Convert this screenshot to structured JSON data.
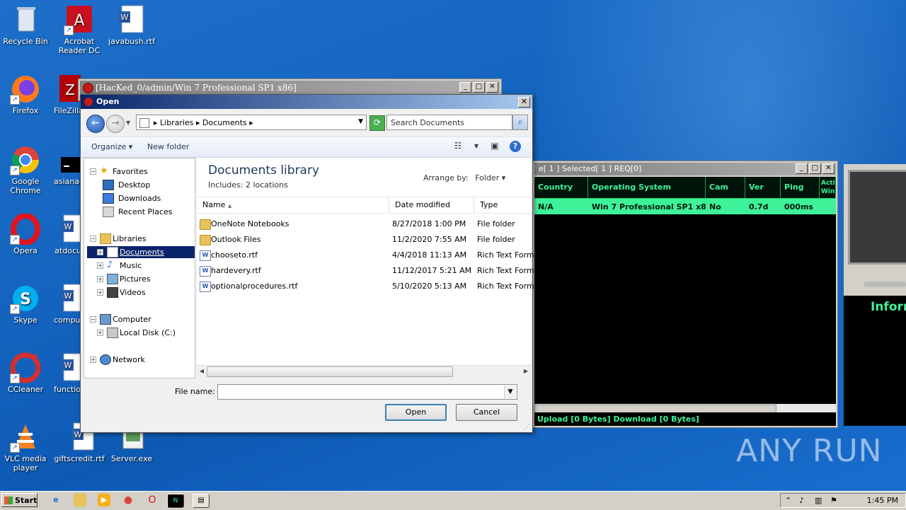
{
  "desktop": {
    "icons": [
      {
        "label": "Recycle Bin",
        "icon": "recycle-bin-icon"
      },
      {
        "label": "Acrobat Reader DC",
        "icon": "acrobat-icon"
      },
      {
        "label": "javabush.rtf",
        "icon": "word-doc-icon"
      },
      {
        "label": "Firefox",
        "icon": "firefox-icon"
      },
      {
        "label": "FileZilla",
        "icon": "filezilla-icon"
      },
      {
        "label": "Google Chrome",
        "icon": "chrome-icon"
      },
      {
        "label": "asianag",
        "icon": "terminal-icon"
      },
      {
        "label": "Opera",
        "icon": "opera-icon"
      },
      {
        "label": "atdocu",
        "icon": "word-doc-icon"
      },
      {
        "label": "Skype",
        "icon": "skype-icon"
      },
      {
        "label": "comput",
        "icon": "word-doc-icon"
      },
      {
        "label": "CCleaner",
        "icon": "ccleaner-icon"
      },
      {
        "label": "function",
        "icon": "word-doc-icon"
      },
      {
        "label": "VLC media player",
        "icon": "vlc-icon"
      },
      {
        "label": "giftscredit.rtf",
        "icon": "word-doc-icon"
      },
      {
        "label": "Server.exe",
        "icon": "exe-icon"
      }
    ],
    "watermark": "ANY RUN"
  },
  "bg_window": {
    "title": "[HacKed_0/admin/Win 7 Professional SP1 x86]"
  },
  "clients_window": {
    "title": "e[ 1 ]   Selected[ 1 ] REQ[0]",
    "columns": [
      "Country",
      "Operating System",
      "Cam",
      "Ver",
      "Ping",
      "Acti Win"
    ],
    "row": [
      "N/A",
      "Win 7 Professional SP1 x86",
      "No",
      "0.7d",
      "000ms",
      ""
    ],
    "status": "Upload [0 Bytes]  Download [0 Bytes]",
    "side_label": "Inform"
  },
  "dialog": {
    "title": "Open",
    "breadcrumb": "▸ Libraries ▸ Documents ▸",
    "search_placeholder": "Search Documents",
    "toolbar": {
      "organize": "Organize ▾",
      "new_folder": "New folder"
    },
    "nav": {
      "favorites": "Favorites",
      "desktop": "Desktop",
      "downloads": "Downloads",
      "recent": "Recent Places",
      "libraries": "Libraries",
      "documents": "Documents",
      "music": "Music",
      "pictures": "Pictures",
      "videos": "Videos",
      "computer": "Computer",
      "local_disk": "Local Disk (C:)",
      "network": "Network"
    },
    "library_title": "Documents library",
    "library_sub": "Includes:  2 locations",
    "arrange_label": "Arrange by:",
    "arrange_value": "Folder ▾",
    "columns": {
      "name": "Name",
      "date": "Date modified",
      "type": "Type"
    },
    "files": [
      {
        "name": "OneNote Notebooks",
        "date": "8/27/2018 1:00 PM",
        "type": "File folder",
        "kind": "folder"
      },
      {
        "name": "Outlook Files",
        "date": "11/2/2020 7:55 AM",
        "type": "File folder",
        "kind": "folder"
      },
      {
        "name": "chooseto.rtf",
        "date": "4/4/2018 11:13 AM",
        "type": "Rich Text Forma",
        "kind": "rtf"
      },
      {
        "name": "hardevery.rtf",
        "date": "11/12/2017 5:21 AM",
        "type": "Rich Text Forma",
        "kind": "rtf"
      },
      {
        "name": "optionalprocedures.rtf",
        "date": "5/10/2020 5:13 AM",
        "type": "Rich Text Forma",
        "kind": "rtf"
      }
    ],
    "file_name_label": "File name:",
    "file_name_value": "",
    "open_label": "Open",
    "cancel_label": "Cancel"
  },
  "taskbar": {
    "start_label": "Start",
    "clock": "1:45 PM"
  }
}
